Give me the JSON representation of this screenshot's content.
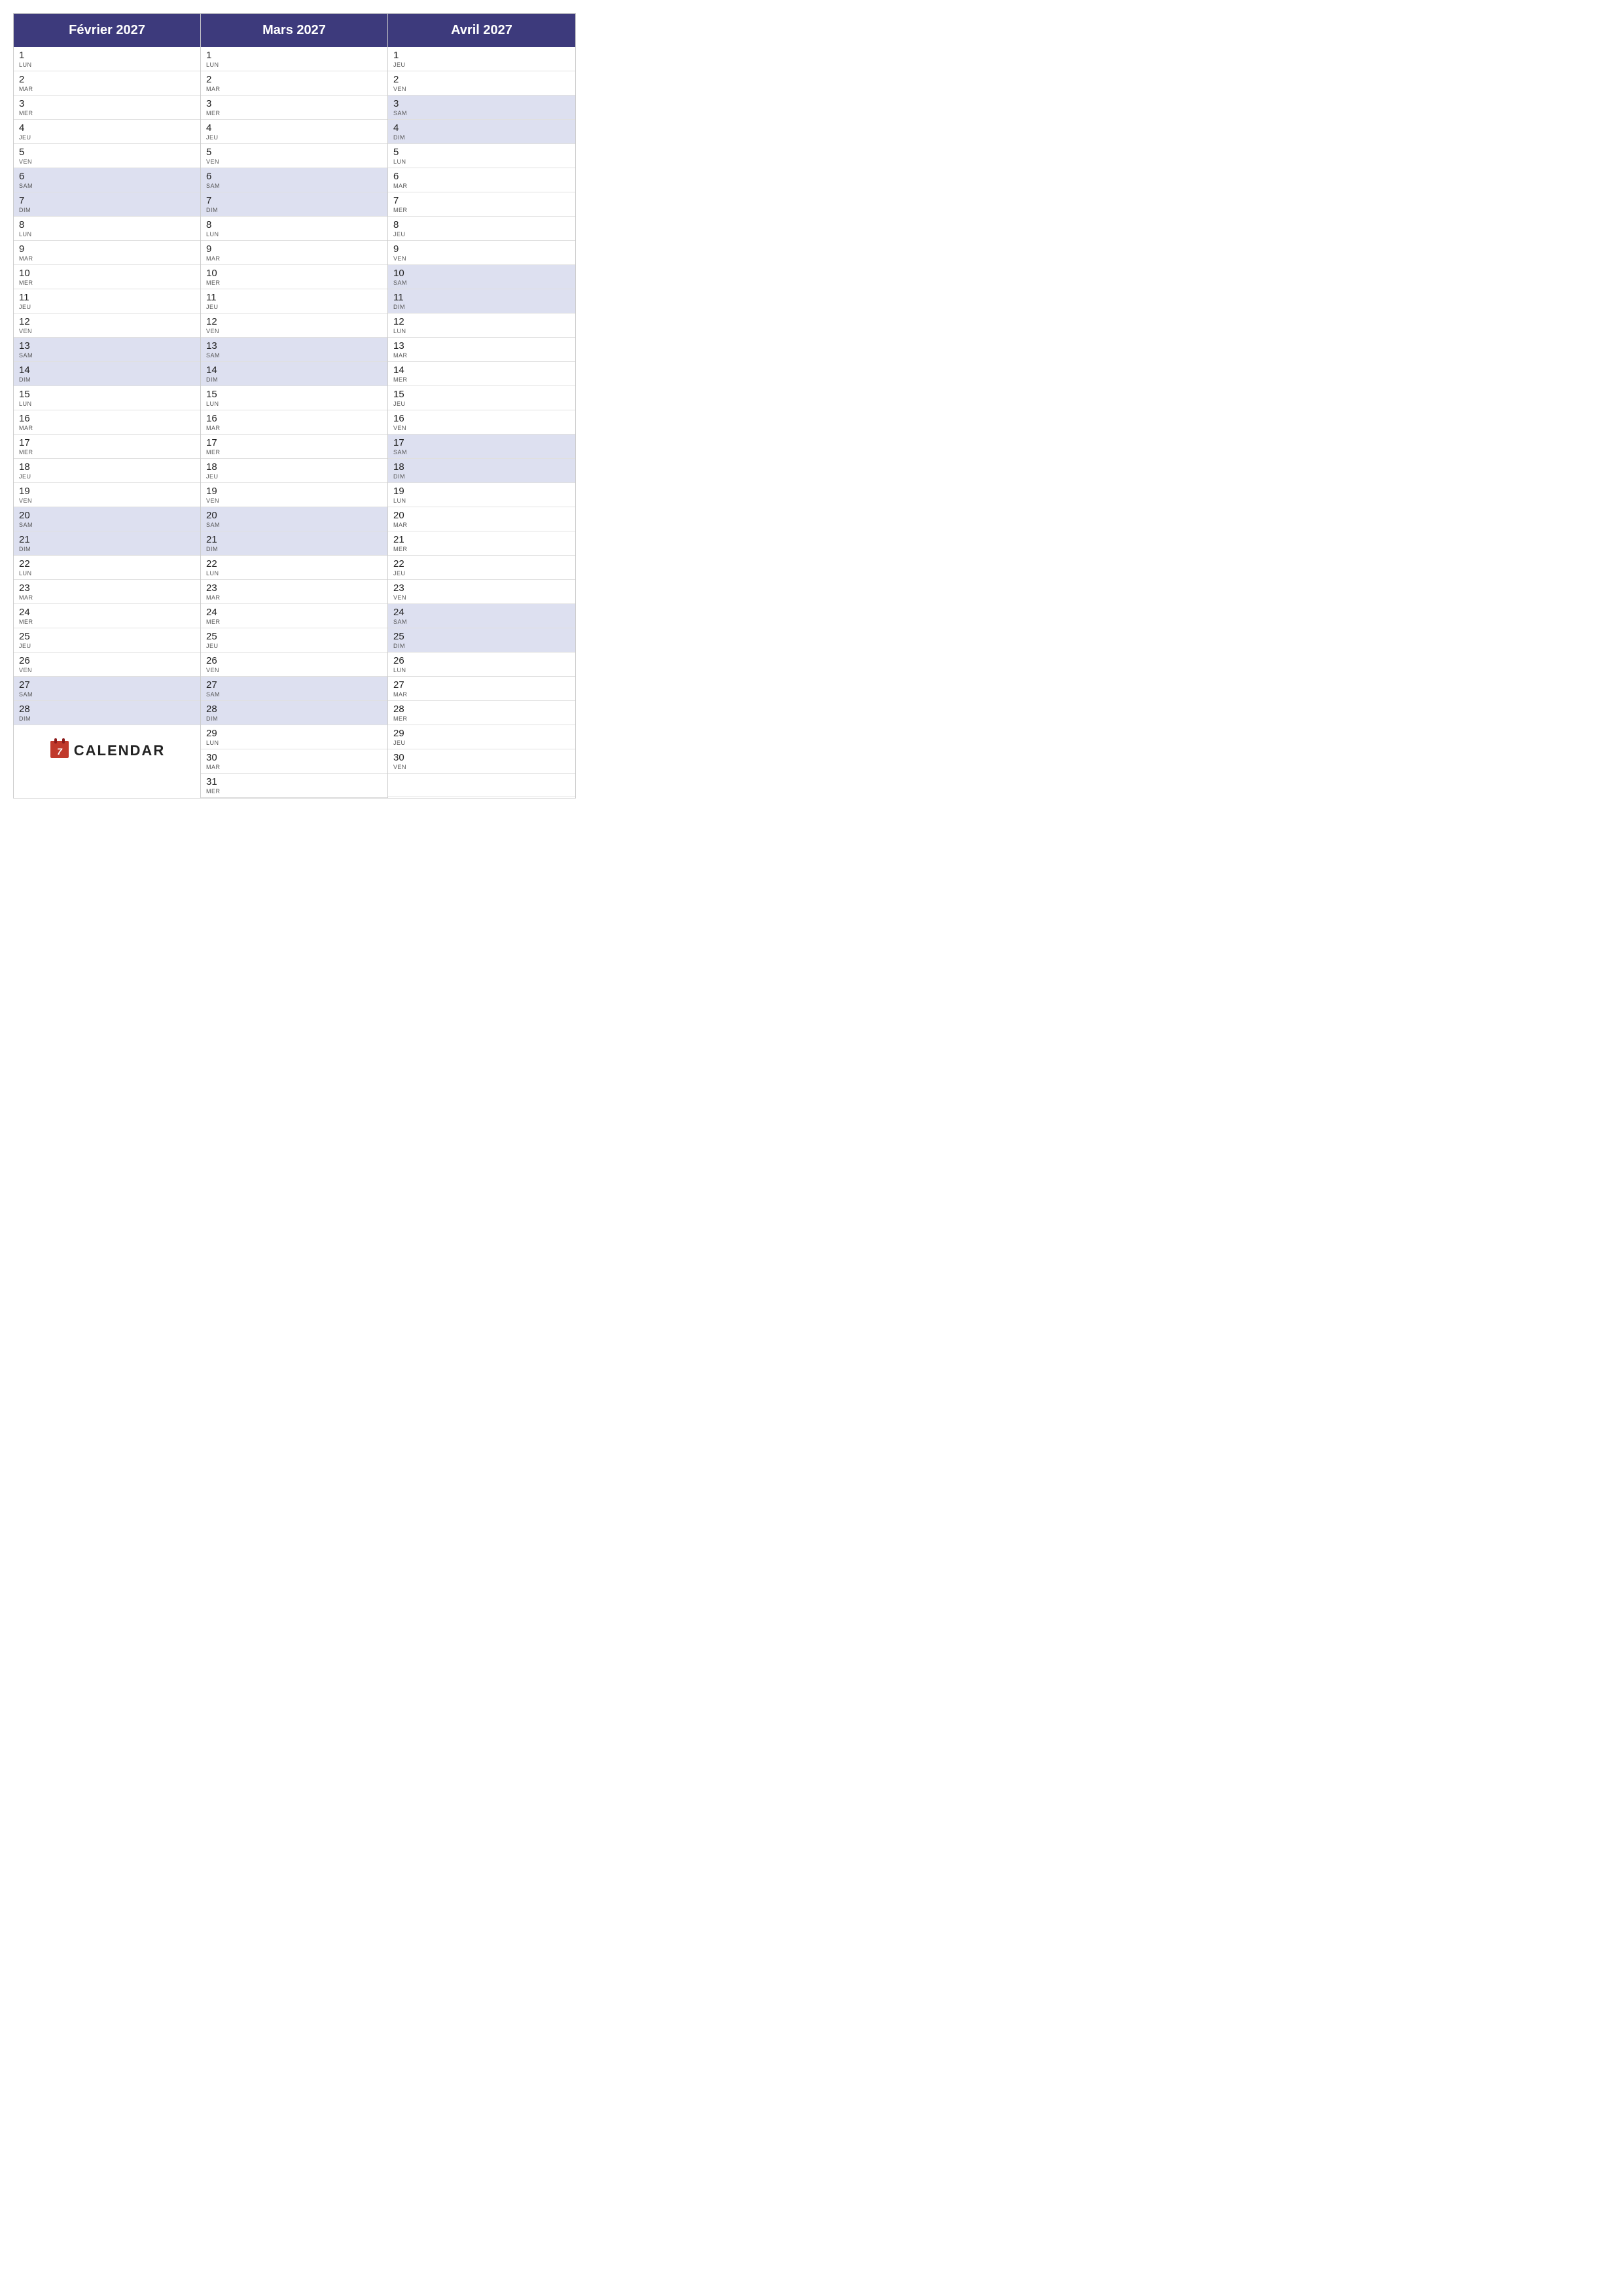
{
  "months": [
    {
      "name": "Février 2027",
      "days": [
        {
          "num": "1",
          "day": "LUN",
          "weekend": false
        },
        {
          "num": "2",
          "day": "MAR",
          "weekend": false
        },
        {
          "num": "3",
          "day": "MER",
          "weekend": false
        },
        {
          "num": "4",
          "day": "JEU",
          "weekend": false
        },
        {
          "num": "5",
          "day": "VEN",
          "weekend": false
        },
        {
          "num": "6",
          "day": "SAM",
          "weekend": true
        },
        {
          "num": "7",
          "day": "DIM",
          "weekend": true
        },
        {
          "num": "8",
          "day": "LUN",
          "weekend": false
        },
        {
          "num": "9",
          "day": "MAR",
          "weekend": false
        },
        {
          "num": "10",
          "day": "MER",
          "weekend": false
        },
        {
          "num": "11",
          "day": "JEU",
          "weekend": false
        },
        {
          "num": "12",
          "day": "VEN",
          "weekend": false
        },
        {
          "num": "13",
          "day": "SAM",
          "weekend": true
        },
        {
          "num": "14",
          "day": "DIM",
          "weekend": true
        },
        {
          "num": "15",
          "day": "LUN",
          "weekend": false
        },
        {
          "num": "16",
          "day": "MAR",
          "weekend": false
        },
        {
          "num": "17",
          "day": "MER",
          "weekend": false
        },
        {
          "num": "18",
          "day": "JEU",
          "weekend": false
        },
        {
          "num": "19",
          "day": "VEN",
          "weekend": false
        },
        {
          "num": "20",
          "day": "SAM",
          "weekend": true
        },
        {
          "num": "21",
          "day": "DIM",
          "weekend": true
        },
        {
          "num": "22",
          "day": "LUN",
          "weekend": false
        },
        {
          "num": "23",
          "day": "MAR",
          "weekend": false
        },
        {
          "num": "24",
          "day": "MER",
          "weekend": false
        },
        {
          "num": "25",
          "day": "JEU",
          "weekend": false
        },
        {
          "num": "26",
          "day": "VEN",
          "weekend": false
        },
        {
          "num": "27",
          "day": "SAM",
          "weekend": true
        },
        {
          "num": "28",
          "day": "DIM",
          "weekend": true
        }
      ],
      "extra_days": 3,
      "show_logo": true
    },
    {
      "name": "Mars 2027",
      "days": [
        {
          "num": "1",
          "day": "LUN",
          "weekend": false
        },
        {
          "num": "2",
          "day": "MAR",
          "weekend": false
        },
        {
          "num": "3",
          "day": "MER",
          "weekend": false
        },
        {
          "num": "4",
          "day": "JEU",
          "weekend": false
        },
        {
          "num": "5",
          "day": "VEN",
          "weekend": false
        },
        {
          "num": "6",
          "day": "SAM",
          "weekend": true
        },
        {
          "num": "7",
          "day": "DIM",
          "weekend": true
        },
        {
          "num": "8",
          "day": "LUN",
          "weekend": false
        },
        {
          "num": "9",
          "day": "MAR",
          "weekend": false
        },
        {
          "num": "10",
          "day": "MER",
          "weekend": false
        },
        {
          "num": "11",
          "day": "JEU",
          "weekend": false
        },
        {
          "num": "12",
          "day": "VEN",
          "weekend": false
        },
        {
          "num": "13",
          "day": "SAM",
          "weekend": true
        },
        {
          "num": "14",
          "day": "DIM",
          "weekend": true
        },
        {
          "num": "15",
          "day": "LUN",
          "weekend": false
        },
        {
          "num": "16",
          "day": "MAR",
          "weekend": false
        },
        {
          "num": "17",
          "day": "MER",
          "weekend": false
        },
        {
          "num": "18",
          "day": "JEU",
          "weekend": false
        },
        {
          "num": "19",
          "day": "VEN",
          "weekend": false
        },
        {
          "num": "20",
          "day": "SAM",
          "weekend": true
        },
        {
          "num": "21",
          "day": "DIM",
          "weekend": true
        },
        {
          "num": "22",
          "day": "LUN",
          "weekend": false
        },
        {
          "num": "23",
          "day": "MAR",
          "weekend": false
        },
        {
          "num": "24",
          "day": "MER",
          "weekend": false
        },
        {
          "num": "25",
          "day": "JEU",
          "weekend": false
        },
        {
          "num": "26",
          "day": "VEN",
          "weekend": false
        },
        {
          "num": "27",
          "day": "SAM",
          "weekend": true
        },
        {
          "num": "28",
          "day": "DIM",
          "weekend": true
        },
        {
          "num": "29",
          "day": "LUN",
          "weekend": false
        },
        {
          "num": "30",
          "day": "MAR",
          "weekend": false
        },
        {
          "num": "31",
          "day": "MER",
          "weekend": false
        }
      ],
      "extra_days": 0,
      "show_logo": false
    },
    {
      "name": "Avril 2027",
      "days": [
        {
          "num": "1",
          "day": "JEU",
          "weekend": false
        },
        {
          "num": "2",
          "day": "VEN",
          "weekend": false
        },
        {
          "num": "3",
          "day": "SAM",
          "weekend": true
        },
        {
          "num": "4",
          "day": "DIM",
          "weekend": true
        },
        {
          "num": "5",
          "day": "LUN",
          "weekend": false
        },
        {
          "num": "6",
          "day": "MAR",
          "weekend": false
        },
        {
          "num": "7",
          "day": "MER",
          "weekend": false
        },
        {
          "num": "8",
          "day": "JEU",
          "weekend": false
        },
        {
          "num": "9",
          "day": "VEN",
          "weekend": false
        },
        {
          "num": "10",
          "day": "SAM",
          "weekend": true
        },
        {
          "num": "11",
          "day": "DIM",
          "weekend": true
        },
        {
          "num": "12",
          "day": "LUN",
          "weekend": false
        },
        {
          "num": "13",
          "day": "MAR",
          "weekend": false
        },
        {
          "num": "14",
          "day": "MER",
          "weekend": false
        },
        {
          "num": "15",
          "day": "JEU",
          "weekend": false
        },
        {
          "num": "16",
          "day": "VEN",
          "weekend": false
        },
        {
          "num": "17",
          "day": "SAM",
          "weekend": true
        },
        {
          "num": "18",
          "day": "DIM",
          "weekend": true
        },
        {
          "num": "19",
          "day": "LUN",
          "weekend": false
        },
        {
          "num": "20",
          "day": "MAR",
          "weekend": false
        },
        {
          "num": "21",
          "day": "MER",
          "weekend": false
        },
        {
          "num": "22",
          "day": "JEU",
          "weekend": false
        },
        {
          "num": "23",
          "day": "VEN",
          "weekend": false
        },
        {
          "num": "24",
          "day": "SAM",
          "weekend": true
        },
        {
          "num": "25",
          "day": "DIM",
          "weekend": true
        },
        {
          "num": "26",
          "day": "LUN",
          "weekend": false
        },
        {
          "num": "27",
          "day": "MAR",
          "weekend": false
        },
        {
          "num": "28",
          "day": "MER",
          "weekend": false
        },
        {
          "num": "29",
          "day": "JEU",
          "weekend": false
        },
        {
          "num": "30",
          "day": "VEN",
          "weekend": false
        }
      ],
      "extra_days": 1,
      "show_logo": false
    }
  ],
  "logo": {
    "icon": "7",
    "text": "CALENDAR"
  }
}
